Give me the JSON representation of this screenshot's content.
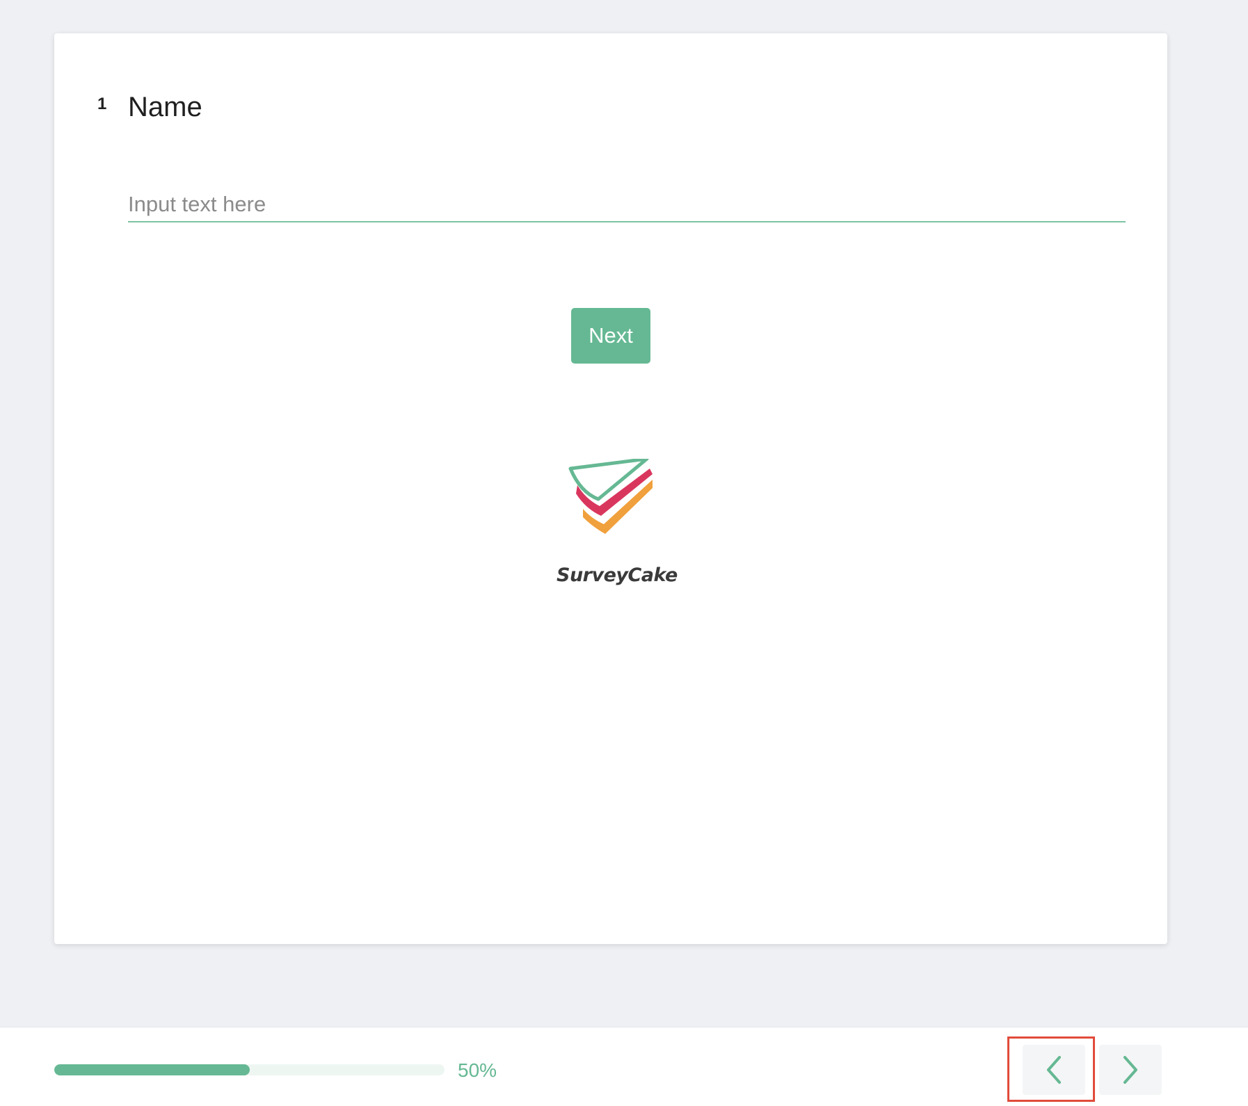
{
  "question": {
    "number": "1",
    "title": "Name",
    "input_placeholder": "Input text here",
    "input_value": ""
  },
  "buttons": {
    "next_label": "Next"
  },
  "brand": {
    "logo_text": "SurveyCake",
    "colors": {
      "green": "#65b893",
      "red": "#d9365e",
      "orange": "#f0a03c"
    }
  },
  "progress": {
    "percent": 50,
    "label": "50%"
  },
  "navigation": {
    "prev_icon": "chevron-left-icon",
    "next_icon": "chevron-right-icon"
  },
  "accent_color": "#65b893",
  "highlight_color": "#e14b3b"
}
